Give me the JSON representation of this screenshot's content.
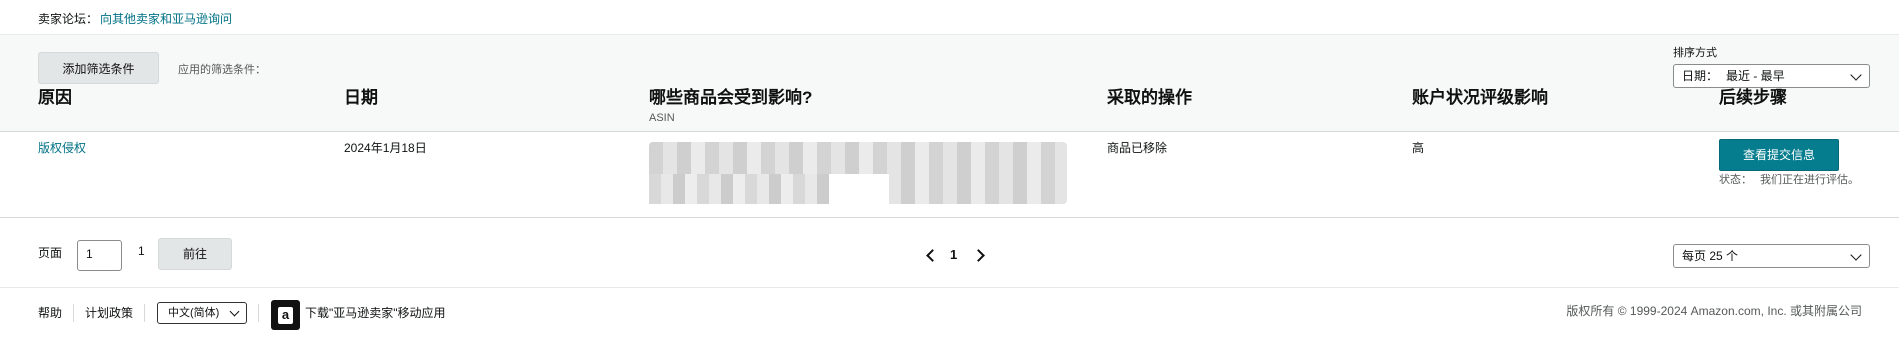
{
  "forum": {
    "label": "卖家论坛：",
    "link": "向其他卖家和亚马逊询问"
  },
  "filters": {
    "add_button": "添加筛选条件",
    "applied_label": "应用的筛选条件："
  },
  "sort": {
    "label": "排序方式",
    "field": "日期：",
    "value": "最近 - 最早"
  },
  "table": {
    "headers": {
      "reason": "原因",
      "date": "日期",
      "affected": "哪些商品会受到影响?",
      "affected_sub": "ASIN",
      "action": "采取的操作",
      "health_impact": "账户状况评级影响",
      "next_steps": "后续步骤"
    },
    "rows": [
      {
        "reason": "版权侵权",
        "date": "2024年1月18日",
        "action": "商品已移除",
        "impact": "高",
        "next_button": "查看提交信息",
        "status_label": "状态：",
        "status_value": "我们正在进行评估。"
      }
    ]
  },
  "pagination": {
    "page_label": "页面",
    "page_input": "1",
    "total_pages": "1",
    "go_button": "前往",
    "current_page": "1",
    "per_page": "每页 25 个"
  },
  "footer": {
    "help": "帮助",
    "policies": "计划政策",
    "language": "中文(简体)",
    "app_icon_glyph": "a",
    "app_download": "下载\"亚马逊卖家\"移动应用",
    "copyright": "版权所有 © 1999-2024 Amazon.com, Inc. 或其附属公司"
  },
  "colors": {
    "accent": "#067d8e",
    "link": "#007185"
  }
}
